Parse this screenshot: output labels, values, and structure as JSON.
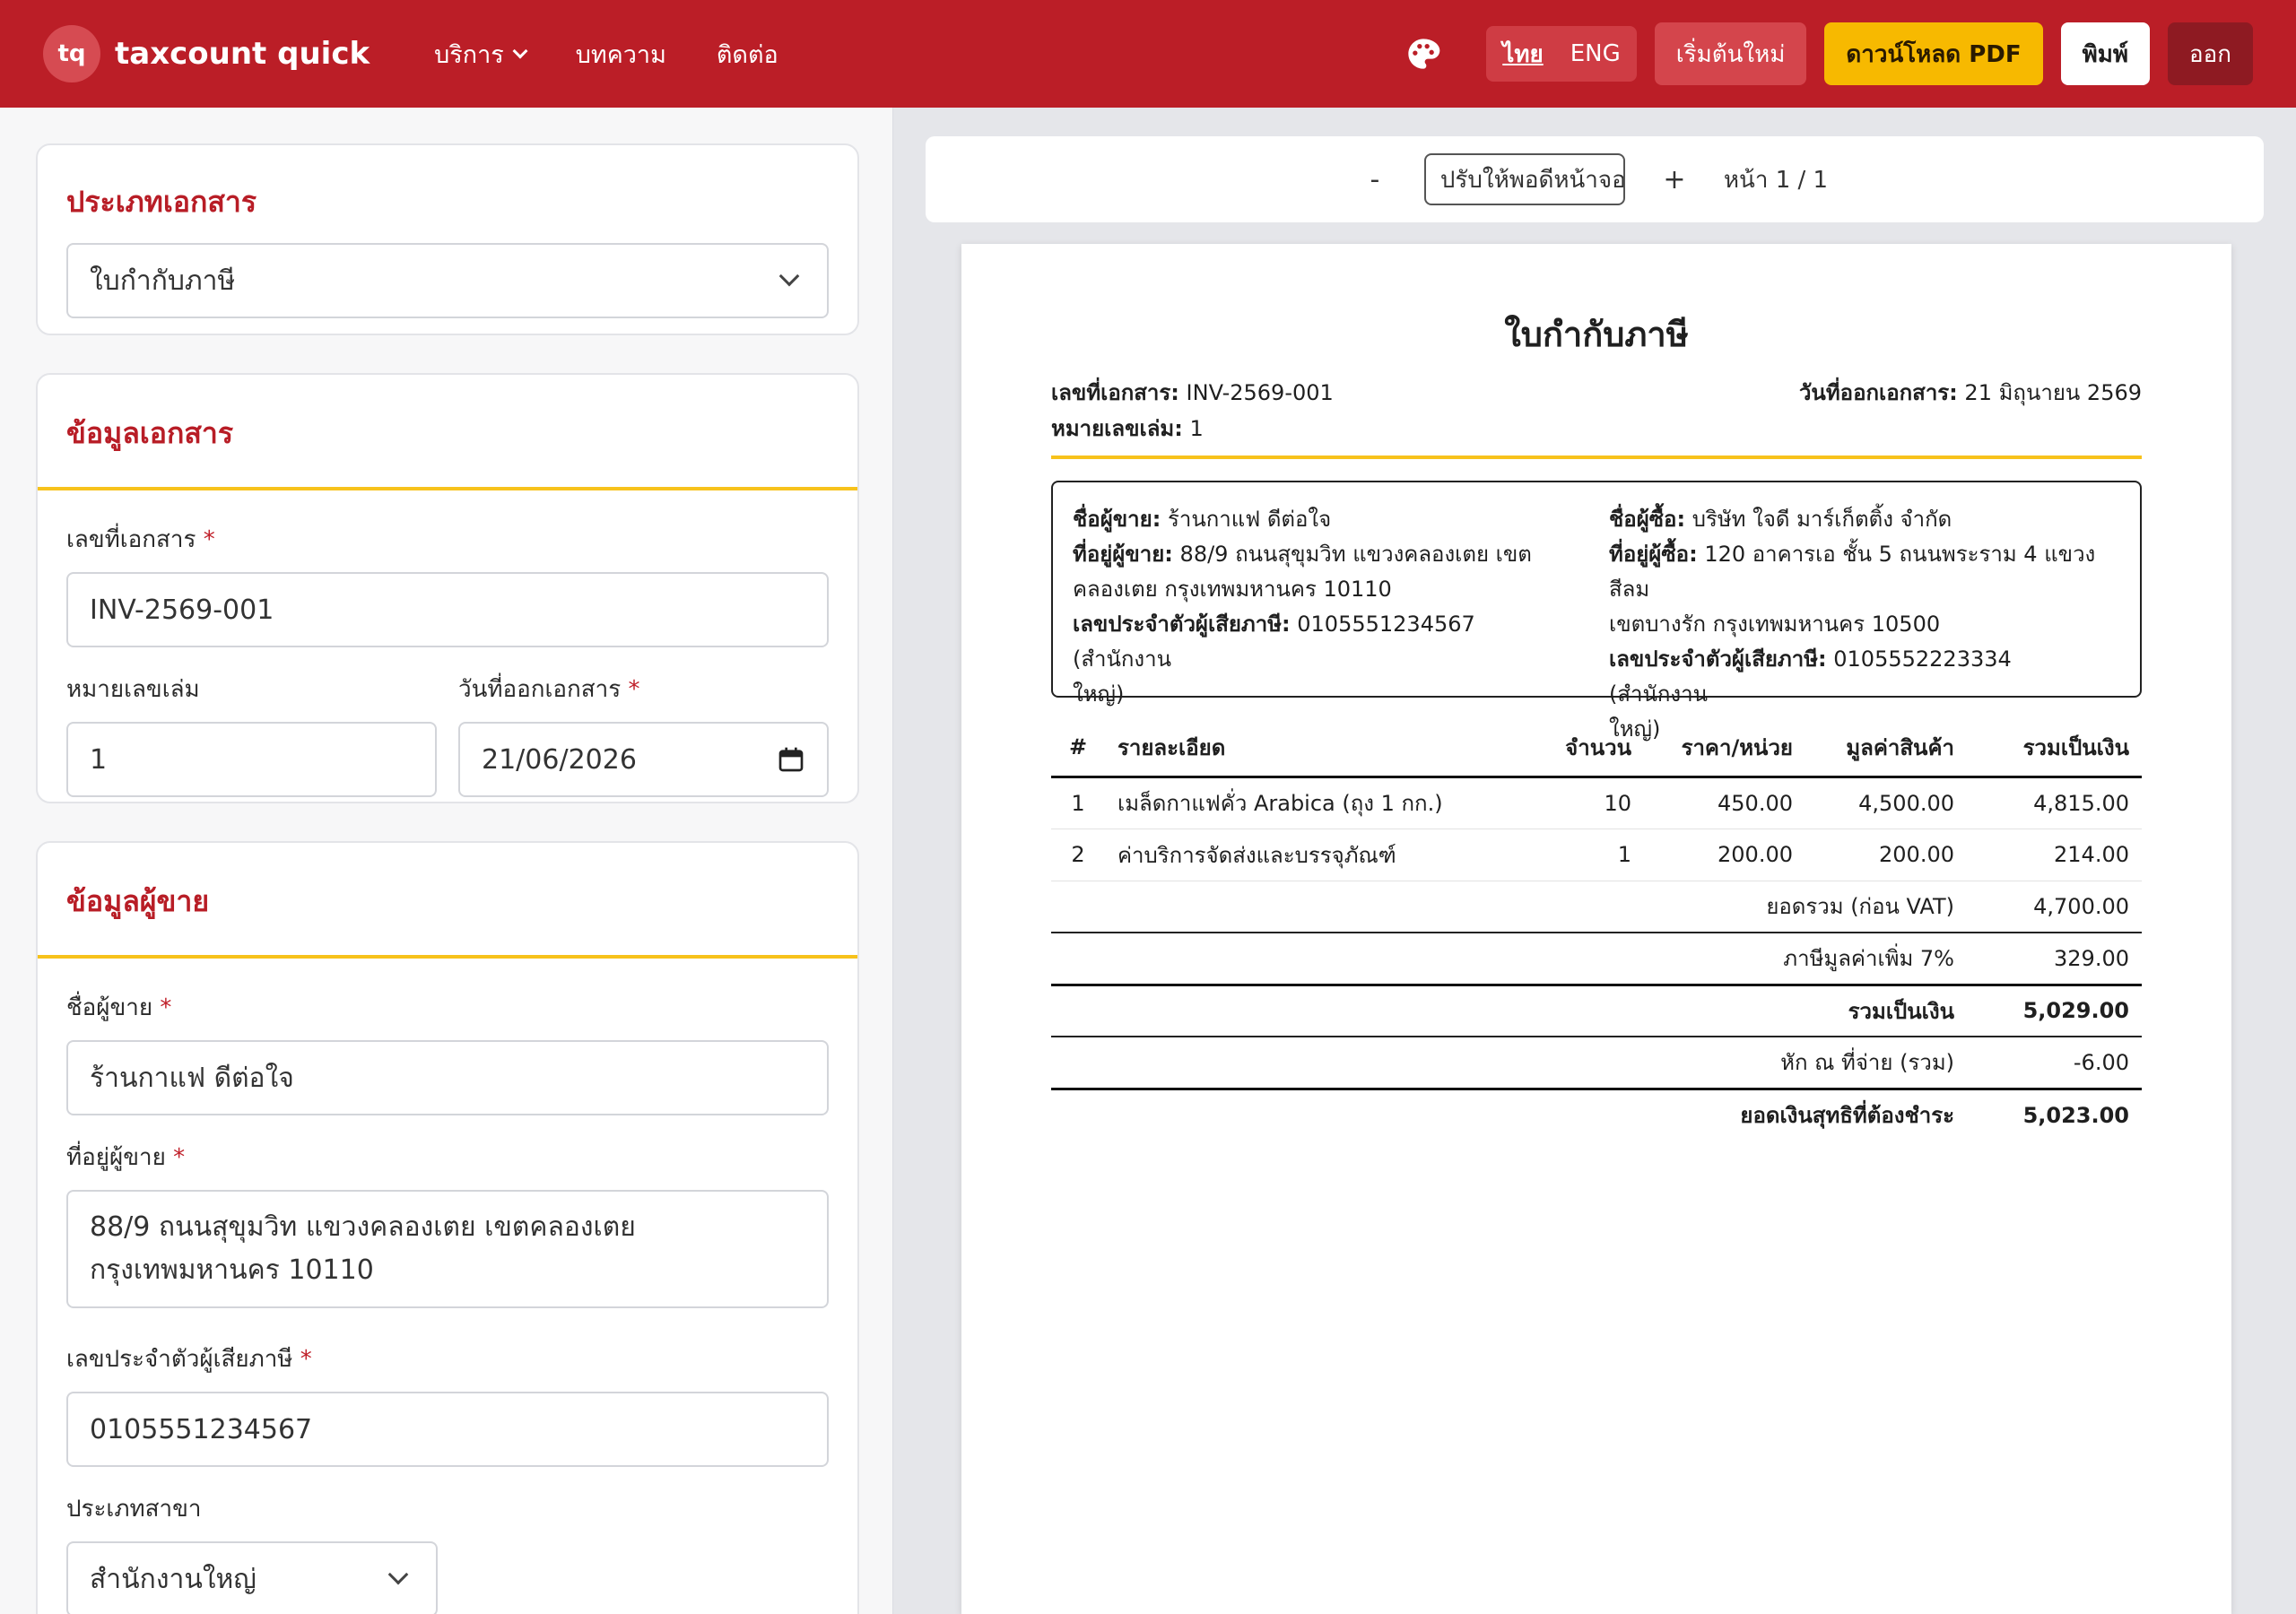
{
  "brand": {
    "logo": "tq",
    "name": "taxcount quick"
  },
  "nav": {
    "services": "บริการ",
    "articles": "บทความ",
    "contact": "ติดต่อ"
  },
  "lang": {
    "thai": "ไทย",
    "eng": "ENG"
  },
  "toolbar": {
    "reset": "เริ่มต้นใหม่",
    "pdf": "ดาวน์โหลด PDF",
    "print": "พิมพ์",
    "exit": "ออก"
  },
  "form": {
    "doc_type": {
      "title": "ประเภทเอกสาร",
      "value": "ใบกำกับภาษี"
    },
    "doc_info": {
      "title": "ข้อมูลเอกสาร",
      "doc_no_label": "เลขที่เอกสาร",
      "doc_no": "INV-2569-001",
      "book_no_label": "หมายเลขเล่ม",
      "book_no": "1",
      "date_label": "วันที่ออกเอกสาร",
      "date": "21/06/2026"
    },
    "seller": {
      "title": "ข้อมูลผู้ขาย",
      "name_label": "ชื่อผู้ขาย",
      "name": "ร้านกาแฟ ดีต่อใจ",
      "address_label": "ที่อยู่ผู้ขาย",
      "address_line1": "88/9 ถนนสุขุมวิท แขวงคลองเตย เขตคลองเตย",
      "address_line2": "กรุงเทพมหานคร 10110",
      "tax_label": "เลขประจำตัวผู้เสียภาษี",
      "tax": "0105551234567",
      "branch_label": "ประเภทสาขา",
      "branch": "สำนักงานใหญ่"
    }
  },
  "viewer": {
    "minus": "-",
    "plus": "+",
    "zoom": "ปรับให้พอดีหน้าจอ",
    "page": "หน้า 1 / 1"
  },
  "doc": {
    "title": "ใบกำกับภาษี",
    "no_label": "เลขที่เอกสาร:",
    "no": "INV-2569-001",
    "book_label": "หมายเลขเล่ม:",
    "book": "1",
    "date_label": "วันที่ออกเอกสาร:",
    "date": "21 มิถุนายน 2569",
    "seller": {
      "name_label": "ชื่อผู้ขาย:",
      "name": "ร้านกาแฟ ดีต่อใจ",
      "addr_label": "ที่อยู่ผู้ขาย:",
      "addr1": "88/9 ถนนสุขุมวิท แขวงคลองเตย เขต",
      "addr2": "คลองเตย กรุงเทพมหานคร 10110",
      "tax_label": "เลขประจำตัวผู้เสียภาษี:",
      "tax1": "0105551234567 (สำนักงาน",
      "tax2": "ใหญ่)"
    },
    "buyer": {
      "name_label": "ชื่อผู้ซื้อ:",
      "name": "บริษัท ใจดี มาร์เก็ตติ้ง จำกัด",
      "addr_label": "ที่อยู่ผู้ซื้อ:",
      "addr1": "120 อาคารเอ ชั้น 5 ถนนพระราม 4 แขวงสีลม",
      "addr2": "เขตบางรัก กรุงเทพมหานคร 10500",
      "tax_label": "เลขประจำตัวผู้เสียภาษี:",
      "tax1": "0105552223334 (สำนักงาน",
      "tax2": "ใหญ่)"
    },
    "columns": [
      "#",
      "รายละเอียด",
      "จำนวน",
      "ราคา/หน่วย",
      "มูลค่าสินค้า",
      "รวมเป็นเงิน"
    ],
    "items": [
      [
        "1",
        "เมล็ดกาแฟคั่ว Arabica (ถุง 1 กก.)",
        "10",
        "450.00",
        "4,500.00",
        "4,815.00"
      ],
      [
        "2",
        "ค่าบริการจัดส่งและบรรจุภัณฑ์",
        "1",
        "200.00",
        "200.00",
        "214.00"
      ]
    ],
    "totals": {
      "subtotal_label": "ยอดรวม (ก่อน VAT)",
      "subtotal": "4,700.00",
      "vat_label": "ภาษีมูลค่าเพิ่ม 7%",
      "vat": "329.00",
      "total_label": "รวมเป็นเงิน",
      "total": "5,029.00",
      "wht_label": "หัก ณ ที่จ่าย (รวม)",
      "wht": "-6.00",
      "net_label": "ยอดเงินสุทธิที่ต้องชำระ",
      "net": "5,023.00"
    }
  }
}
